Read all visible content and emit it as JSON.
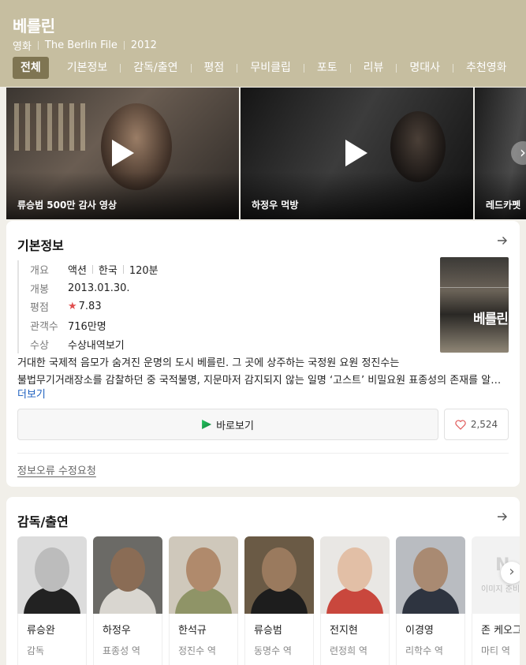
{
  "movie": {
    "title": "베를린",
    "category": "영화",
    "english_title": "The Berlin File",
    "year": "2012"
  },
  "tabs": [
    {
      "label": "전체",
      "active": true
    },
    {
      "label": "기본정보",
      "active": false
    },
    {
      "label": "감독/출연",
      "active": false
    },
    {
      "label": "평점",
      "active": false
    },
    {
      "label": "무비클립",
      "active": false
    },
    {
      "label": "포토",
      "active": false
    },
    {
      "label": "리뷰",
      "active": false
    },
    {
      "label": "명대사",
      "active": false
    },
    {
      "label": "추천영화",
      "active": false
    }
  ],
  "videos": [
    {
      "caption": "류승범 500만 감사 영상"
    },
    {
      "caption": "하정우 먹방"
    },
    {
      "caption": "레드카펫"
    }
  ],
  "basic_info": {
    "section_title": "기본정보",
    "rows": {
      "summary": {
        "key": "개요",
        "genre": "액션",
        "country": "한국",
        "runtime": "120분"
      },
      "release": {
        "key": "개봉",
        "value": "2013.01.30."
      },
      "rating": {
        "key": "평점",
        "star": "★",
        "value": "7.83"
      },
      "audience": {
        "key": "관객수",
        "value": "716만명"
      },
      "award": {
        "key": "수상",
        "value": "수상내역보기"
      }
    },
    "poster_title": "베를린",
    "synopsis_line1": "거대한 국제적 음모가 숨겨진 운명의 도시 베를린. 그 곳에 상주하는 국정원 요원 정진수는",
    "synopsis_line2": "불법무기거래장소를 감찰하던 중 국적불명, 지문마저 감지되지 않는 일명 ‘고스트’ 비밀요원 표종성의 존재를 알게 된다.",
    "more_label": "더보기",
    "watch_label": "바로보기",
    "like_count": "2,524",
    "report_label": "정보오류 수정요청"
  },
  "cast_section": {
    "title": "감독/출연",
    "people": [
      {
        "name": "류승완",
        "role": "감독"
      },
      {
        "name": "하정우",
        "role": "표종성 역"
      },
      {
        "name": "한석규",
        "role": "정진수 역"
      },
      {
        "name": "류승범",
        "role": "동명수 역"
      },
      {
        "name": "전지현",
        "role": "련정희 역"
      },
      {
        "name": "이경영",
        "role": "리학수 역"
      },
      {
        "name": "존 케오그",
        "role": "마티 역",
        "placeholder_logo": "N",
        "placeholder_text": "이미지 준비중"
      }
    ]
  },
  "colors": {
    "header_bg": "#c6bea0",
    "active_tab_bg": "#7f7552",
    "link": "#1d5fbf",
    "star": "#e04e4e",
    "page_bg": "#f1efe9"
  },
  "icons": [
    "play-icon",
    "arrow-right-icon",
    "chevron-right-icon",
    "heart-icon",
    "star-icon"
  ]
}
